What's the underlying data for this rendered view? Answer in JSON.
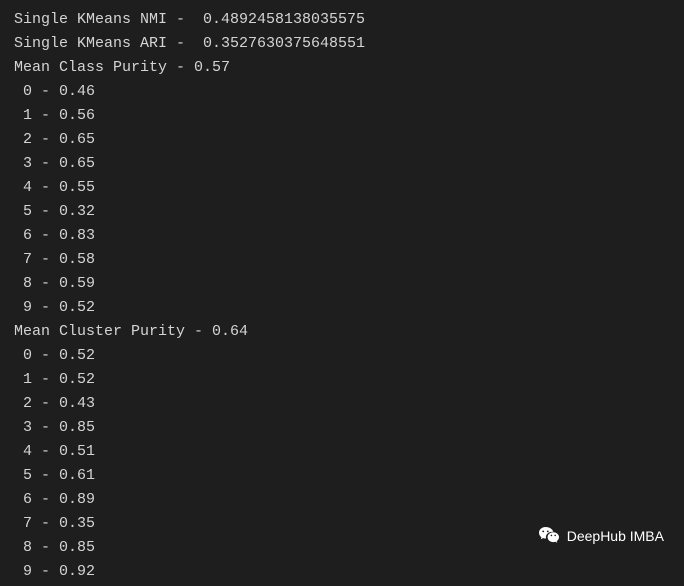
{
  "metrics": {
    "nmi_label": "Single KMeans NMI -  ",
    "nmi_value": "0.4892458138035575",
    "ari_label": "Single KMeans ARI -  ",
    "ari_value": "0.3527630375648551",
    "class_purity_label": "Mean Class Purity - ",
    "class_purity_value": "0.57",
    "cluster_purity_label": "Mean Cluster Purity - ",
    "cluster_purity_value": "0.64"
  },
  "class_purity": [
    {
      "idx": "0",
      "val": "0.46"
    },
    {
      "idx": "1",
      "val": "0.56"
    },
    {
      "idx": "2",
      "val": "0.65"
    },
    {
      "idx": "3",
      "val": "0.65"
    },
    {
      "idx": "4",
      "val": "0.55"
    },
    {
      "idx": "5",
      "val": "0.32"
    },
    {
      "idx": "6",
      "val": "0.83"
    },
    {
      "idx": "7",
      "val": "0.58"
    },
    {
      "idx": "8",
      "val": "0.59"
    },
    {
      "idx": "9",
      "val": "0.52"
    }
  ],
  "cluster_purity": [
    {
      "idx": "0",
      "val": "0.52"
    },
    {
      "idx": "1",
      "val": "0.52"
    },
    {
      "idx": "2",
      "val": "0.43"
    },
    {
      "idx": "3",
      "val": "0.85"
    },
    {
      "idx": "4",
      "val": "0.51"
    },
    {
      "idx": "5",
      "val": "0.61"
    },
    {
      "idx": "6",
      "val": "0.89"
    },
    {
      "idx": "7",
      "val": "0.35"
    },
    {
      "idx": "8",
      "val": "0.85"
    },
    {
      "idx": "9",
      "val": "0.92"
    }
  ],
  "watermark": {
    "text": "DeepHub IMBA"
  }
}
